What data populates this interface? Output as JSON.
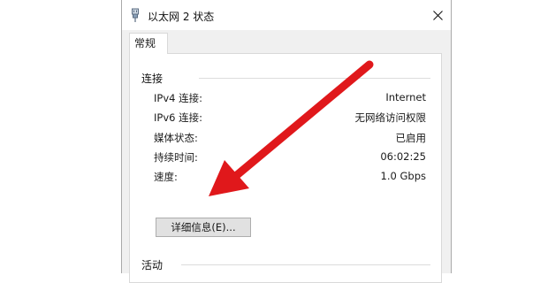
{
  "window": {
    "title": "以太网 2 状态",
    "close_symbol": "✕"
  },
  "tabs": [
    {
      "label": "常规"
    }
  ],
  "connection": {
    "group_label": "连接",
    "rows": [
      {
        "label": "IPv4 连接:",
        "value": "Internet"
      },
      {
        "label": "IPv6 连接:",
        "value": "无网络访问权限"
      },
      {
        "label": "媒体状态:",
        "value": "已启用"
      },
      {
        "label": "持续时间:",
        "value": "06:02:25"
      },
      {
        "label": "速度:",
        "value": "1.0 Gbps"
      }
    ],
    "details_button": "详细信息(E)..."
  },
  "activity": {
    "group_label": "活动"
  },
  "annotation": {
    "arrow_color": "#e0181b"
  },
  "icons": {
    "title": "network-adapter-icon",
    "close": "close-icon"
  }
}
